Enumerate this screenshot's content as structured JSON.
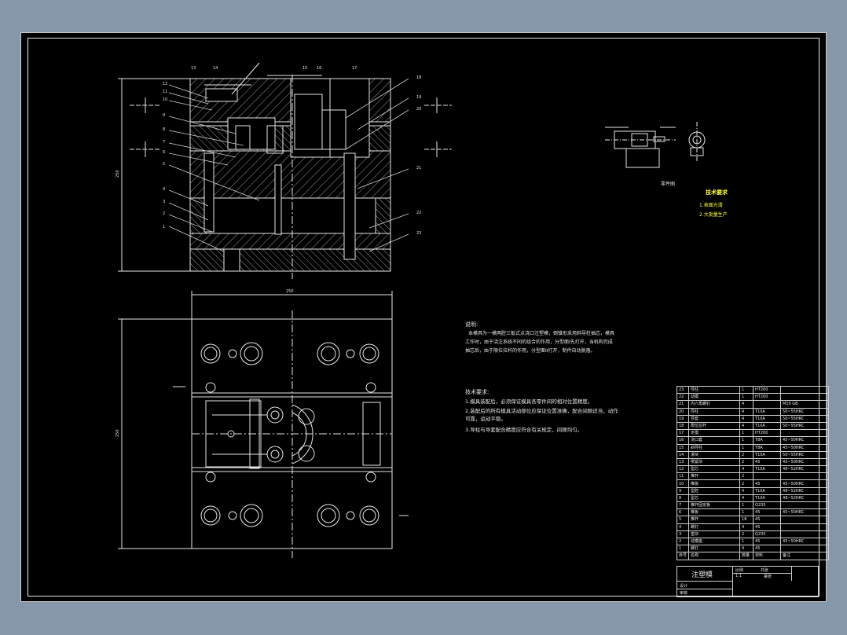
{
  "drawing": {
    "part_view_label": "零件图",
    "tech_req_panel": {
      "title": "技术要求",
      "items": [
        "1.表面光滑",
        "2.大批量生产"
      ]
    },
    "description": {
      "heading": "说明:",
      "lines": [
        "本模具为一模两腔三板式点浇口注塑模，倒锥形采用斜导柱抽芯，模具",
        "工作时，由于浇注系统不同的组合的作用，分型面I先打开，当机构完成",
        "抽芯后，由于限位拉杆的作用，分型面II打开，制件自动脱落。"
      ]
    },
    "tech_requirements": {
      "title": "技术要求:",
      "lines": [
        "1.模具装配后，必须保证模具各零件间的相对位置精度。",
        "2.装配后的所有模具活动部位应保证位置准确，配合间隙适当，动作",
        "可靠，运动平稳。",
        "3.导柱与导套配合精度应符合有关规定，间隙均匀。"
      ]
    },
    "dimensions": {
      "top_width": "250",
      "left_height_top": "250",
      "left_height_bottom": "250"
    },
    "callouts": {
      "top_left": [
        "13",
        "14",
        "15",
        "16",
        "17"
      ],
      "left": [
        "12",
        "11",
        "10",
        "9",
        "8",
        "7",
        "6",
        "5",
        "4",
        "3",
        "2",
        "1"
      ],
      "right": [
        "18",
        "19",
        "20",
        "21",
        "22",
        "23"
      ]
    },
    "bom": [
      [
        "23",
        "导柱",
        "1",
        "HT200",
        ""
      ],
      [
        "22",
        "动模",
        "1",
        "HT200",
        ""
      ],
      [
        "21",
        "内六角螺钉",
        "4",
        "",
        "M10 GB"
      ],
      [
        "20",
        "导柱",
        "4",
        "T10A",
        "50~55HRC"
      ],
      [
        "19",
        "导套",
        "4",
        "T10A",
        "50~55HRC"
      ],
      [
        "18",
        "限位拉杆",
        "4",
        "T10A",
        "50~55HRC"
      ],
      [
        "17",
        "定模",
        "1",
        "HT200",
        ""
      ],
      [
        "16",
        "浇口套",
        "1",
        "T8A",
        "45~50HRC"
      ],
      [
        "15",
        "斜导柱",
        "1",
        "T8A",
        "45~50HRC"
      ],
      [
        "14",
        "滑块",
        "2",
        "T10A",
        "50~55HRC"
      ],
      [
        "13",
        "楔紧块",
        "2",
        "45",
        "45~50HRC"
      ],
      [
        "12",
        "型芯",
        "4",
        "T10A",
        "48~52HRC"
      ],
      [
        "11",
        "推杆",
        "2",
        "",
        ""
      ],
      [
        "10",
        "推板",
        "2",
        "45",
        "45~50HRC"
      ],
      [
        "9",
        "型腔",
        "4",
        "T10A",
        "48~52HRC"
      ],
      [
        "8",
        "型芯",
        "4",
        "T10A",
        "48~52HRC"
      ],
      [
        "7",
        "推杆固定板",
        "1",
        "Q235",
        ""
      ],
      [
        "6",
        "推板",
        "1",
        "45",
        "45~50HRC"
      ],
      [
        "5",
        "推杆",
        "18",
        "45",
        ""
      ],
      [
        "4",
        "螺钉",
        "4",
        "45",
        ""
      ],
      [
        "3",
        "垫块",
        "2",
        "Q235",
        ""
      ],
      [
        "2",
        "动模座",
        "1",
        "45",
        "45~50HRC"
      ],
      [
        "1",
        "螺钉",
        "4",
        "45",
        ""
      ],
      [
        "序号",
        "名称",
        "数量",
        "材料",
        "备注"
      ]
    ],
    "title_block": {
      "name": "注塑模",
      "scale_label": "比例",
      "scale": "1:1",
      "sheet_label": "共张",
      "sheet": "第张",
      "design_label": "设计",
      "check_label": "审核"
    },
    "colors": {
      "background": "#8797aa",
      "paper": "#000000",
      "lines": "#e6e6e6",
      "accent": "#ffff33"
    }
  }
}
